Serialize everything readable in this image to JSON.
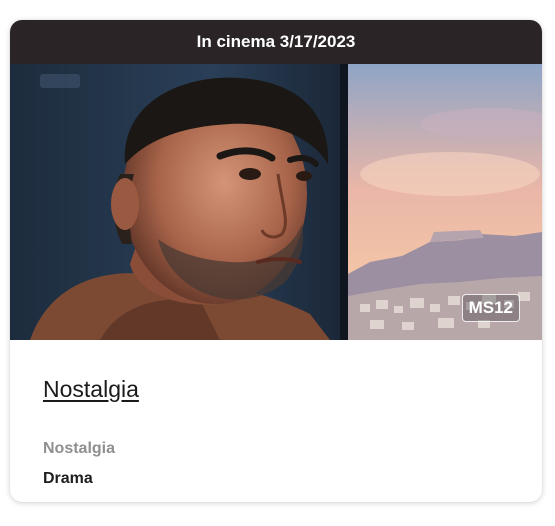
{
  "movie_card": {
    "release_banner": "In cinema 3/17/2023",
    "rating_badge": "MS12",
    "title": "Nostalgia",
    "original_title": "Nostalgia",
    "genre": "Drama",
    "poster_icon": "movie-poster-image"
  },
  "colors": {
    "banner_bg": "#2a2426",
    "text_dark": "#1a1a1a",
    "text_muted": "#8f8f8f"
  }
}
